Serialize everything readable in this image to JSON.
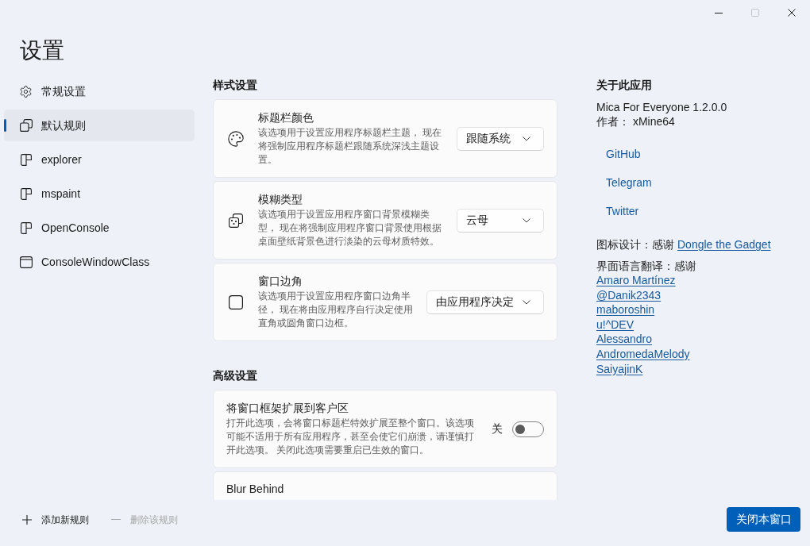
{
  "window_controls": [
    {
      "kind": "minimize",
      "disabled": false
    },
    {
      "kind": "maximize",
      "disabled": true
    },
    {
      "kind": "close",
      "disabled": false
    }
  ],
  "page_title": "设置",
  "sidebar": {
    "items": [
      {
        "kind": "general",
        "label": "常规设置",
        "selected": false
      },
      {
        "kind": "default_rule",
        "label": "默认规则",
        "selected": true
      },
      {
        "kind": "process_rule",
        "label": "explorer",
        "selected": false
      },
      {
        "kind": "process_rule",
        "label": "mspaint",
        "selected": false
      },
      {
        "kind": "process_rule",
        "label": "OpenConsole",
        "selected": false
      },
      {
        "kind": "class_rule",
        "label": "ConsoleWindowClass",
        "selected": false
      }
    ]
  },
  "sections": [
    {
      "heading": "样式设置",
      "settings": [
        {
          "kind": "dropdown",
          "title": "标题栏颜色",
          "description": "该选项用于设置应用程序标题栏主题， 现在将强制应用程序标题栏跟随系统深浅主题设置。",
          "value": "跟随系统"
        },
        {
          "kind": "dropdown",
          "title": "模糊类型",
          "description": "该选项用于设置应用程序窗口背景模糊类型， 现在将强制应用程序窗口背景使用根据桌面壁纸背景色进行淡染的云母材质特效。",
          "value": "云母"
        },
        {
          "kind": "dropdown",
          "title": "窗口边角",
          "description": "该选项用于设置应用程序窗口边角半径， 现在将由应用程序自行决定使用直角或圆角窗口边框。",
          "value": "由应用程序决定"
        }
      ]
    },
    {
      "heading": "高级设置",
      "settings": [
        {
          "kind": "toggle",
          "title": "将窗口框架扩展到客户区",
          "description": "打开此选项，会将窗口标题栏特效扩展至整个窗口。该选项可能不适用于所有应用程序，甚至会使它们崩溃，请谨慎打开此选项。 关闭此选项需要重启已生效的窗口。",
          "state_label": "关",
          "on": false
        },
        {
          "kind": "header_only",
          "title": "Blur Behind"
        }
      ]
    }
  ],
  "about": {
    "heading": "关于此应用",
    "app": "Mica For Everyone 1.2.0.0",
    "author": "作者： xMine64",
    "links": [
      "GitHub",
      "Telegram",
      "Twitter"
    ],
    "icon_credit": {
      "label": "图标设计：感谢",
      "link": "Dongle the Gadget"
    },
    "translation_credit": {
      "label": "界面语言翻译：感谢",
      "names": [
        "Amaro Martínez",
        "@Danik2343",
        "maboroshin",
        "u!^DEV",
        "Alessandro",
        "AndromedaMelody",
        "SaiyajinK"
      ]
    }
  },
  "footer": {
    "add_rule": {
      "label": "添加新规则",
      "disabled": false
    },
    "delete_rule": {
      "label": "删除该规则",
      "disabled": true
    },
    "close_button": {
      "label": "关闭本窗口"
    }
  }
}
